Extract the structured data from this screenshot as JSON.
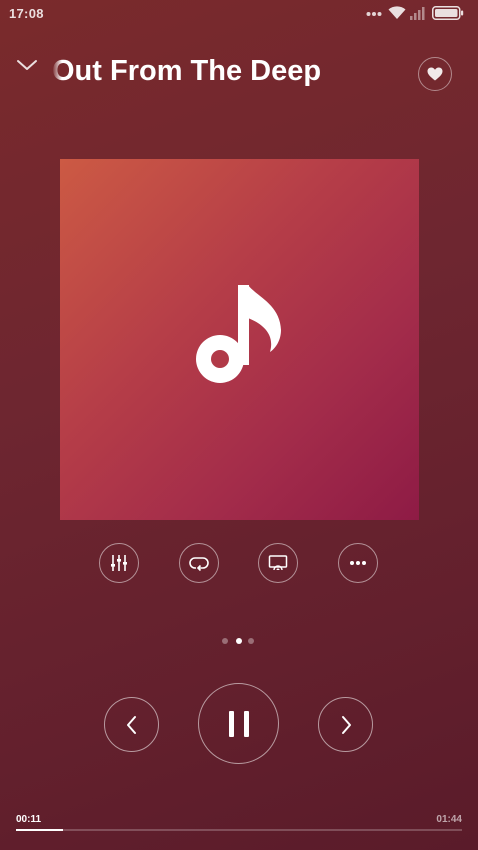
{
  "status_bar": {
    "time": "17:08",
    "icons": [
      "more-dots-icon",
      "wifi-icon",
      "signal-icon",
      "battery-icon"
    ]
  },
  "header": {
    "collapse_icon": "chevron-down-icon",
    "title": "Out From The Deep",
    "favorite_icon": "heart-icon"
  },
  "album_art": {
    "icon": "music-note-icon",
    "gradient_start": "#cc5a44",
    "gradient_end": "#8e1b45"
  },
  "actions": [
    {
      "name": "equalizer",
      "icon": "equalizer-icon"
    },
    {
      "name": "repeat",
      "icon": "repeat-icon"
    },
    {
      "name": "cast",
      "icon": "cast-icon"
    },
    {
      "name": "more",
      "icon": "more-dots-icon"
    }
  ],
  "pager": {
    "count": 3,
    "active_index": 1
  },
  "controls": {
    "previous_icon": "chevron-left-icon",
    "play_pause_icon": "pause-icon",
    "next_icon": "chevron-right-icon"
  },
  "progress": {
    "elapsed": "00:11",
    "total": "01:44",
    "fraction": 0.106
  },
  "colors": {
    "background": "#6e2630",
    "accent": "#ffffff"
  }
}
